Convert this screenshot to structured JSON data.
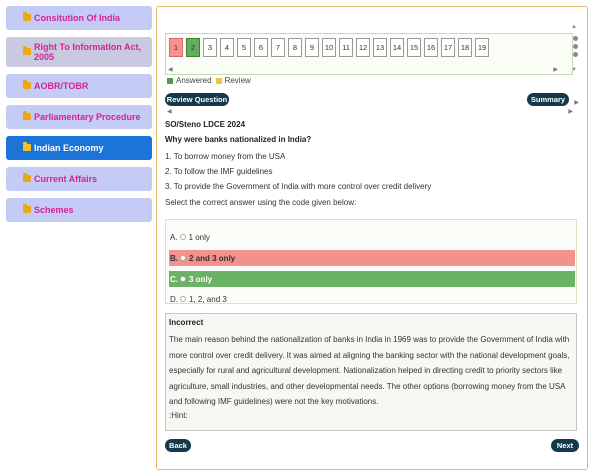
{
  "sidebar": {
    "items": [
      {
        "label": "Consitution Of India"
      },
      {
        "label": "Right To Information Act, 2005"
      },
      {
        "label": "AOBR/TOBR"
      },
      {
        "label": "Parliamentary Procedure"
      },
      {
        "label": "Indian Economy",
        "active": true
      },
      {
        "label": "Current Affairs"
      },
      {
        "label": "Schemes"
      }
    ]
  },
  "question_nav": {
    "numbers": [
      "1",
      "2",
      "3",
      "4",
      "5",
      "6",
      "7",
      "8",
      "9",
      "10",
      "11",
      "12",
      "13",
      "14",
      "15",
      "16",
      "17",
      "18",
      "19"
    ],
    "status": {
      "1": "wrong",
      "2": "answered"
    }
  },
  "legend": {
    "answered": "Answered",
    "review": "Review"
  },
  "buttons": {
    "review": "Review Question",
    "summary": "Summary",
    "back": "Back",
    "next": "Next"
  },
  "question": {
    "exam": "SO/Steno LDCE 2024",
    "text": "Why were banks nationalized in India?",
    "statements": [
      "1. To borrow money from the USA",
      "2. To follow the IMF guidelines",
      "3. To provide the Government of India with more control over credit delivery"
    ],
    "instruction": "Select the correct answer using the code given below:"
  },
  "options": [
    {
      "letter": "A.",
      "text": "1 only",
      "state": "none"
    },
    {
      "letter": "B.",
      "text": "2 and 3 only",
      "state": "wrong"
    },
    {
      "letter": "C.",
      "text": "3 only",
      "state": "correct"
    },
    {
      "letter": "D.",
      "text": "1, 2, and 3",
      "state": "none"
    }
  ],
  "explanation": {
    "title": "Incorrect",
    "body": "The main reason behind the nationalization of banks in India in 1969 was to provide the Government of India with more control over credit delivery. It was aimed at aligning the banking sector with the national development goals, especially for rural and agricultural development. Nationalization helped in directing credit to priority sectors like agriculture, small industries, and other developmental needs. The other options (borrowing money from the USA and following IMF guidelines) were not the key motivations.",
    "hint": ":Hint:"
  },
  "colors": {
    "accent": "#1b74d8",
    "wrong": "#f4918d",
    "correct": "#6ab264",
    "button": "#14394a",
    "border": "#e8b86a"
  }
}
